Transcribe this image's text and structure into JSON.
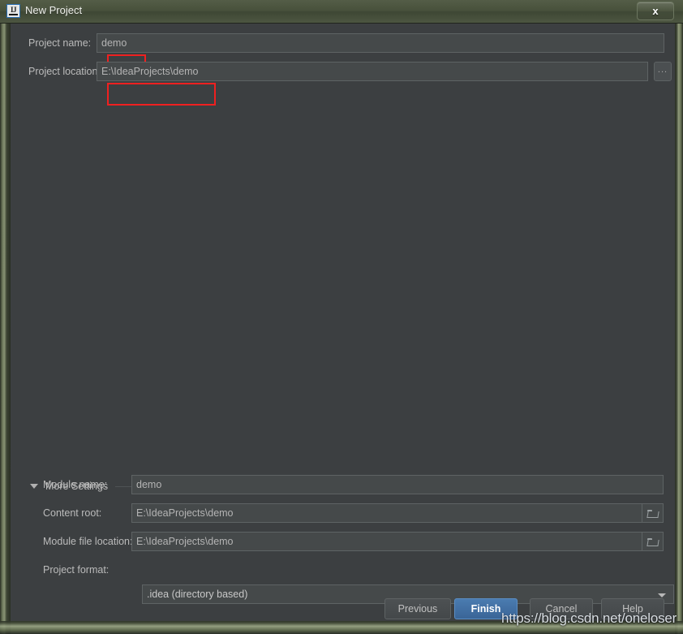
{
  "window": {
    "title": "New Project",
    "app_icon": "intellij-idea-icon",
    "icon_letters": "IJ",
    "close_label": "x",
    "frame_color": "#4a5340",
    "dialog_background": "#3c3f41"
  },
  "main_form": {
    "project_name": {
      "label": "Project name:",
      "value": "demo",
      "annotated": true
    },
    "project_location": {
      "label": "Project location:",
      "value": "E:\\IdeaProjects\\demo",
      "annotated": true,
      "browse_label": "...",
      "browse_icon": "ellipsis-icon"
    }
  },
  "more_settings": {
    "label": "More Settings",
    "expanded": true,
    "triangle_icon": "chevron-down-icon",
    "fields": [
      {
        "label": "Module name:",
        "value": "demo",
        "trailing": "none"
      },
      {
        "label": "Content root:",
        "value": "E:\\IdeaProjects\\demo",
        "trailing": "folder-icon"
      },
      {
        "label": "Module file location:",
        "value": "E:\\IdeaProjects\\demo",
        "trailing": "folder-icon"
      }
    ],
    "project_format": {
      "label": "Project format:",
      "value": ".idea (directory based)",
      "arrow_icon": "chevron-down-icon"
    }
  },
  "footer": {
    "buttons": [
      {
        "label": "Previous",
        "primary": false
      },
      {
        "label": "Finish",
        "primary": true
      },
      {
        "label": "Cancel",
        "primary": false
      },
      {
        "label": "Help",
        "primary": false
      }
    ],
    "primary_color": "#3c6aa0"
  },
  "watermark": {
    "text": "https://blog.csdn.net/oneloser"
  },
  "annotation": {
    "color": "#f02020"
  }
}
